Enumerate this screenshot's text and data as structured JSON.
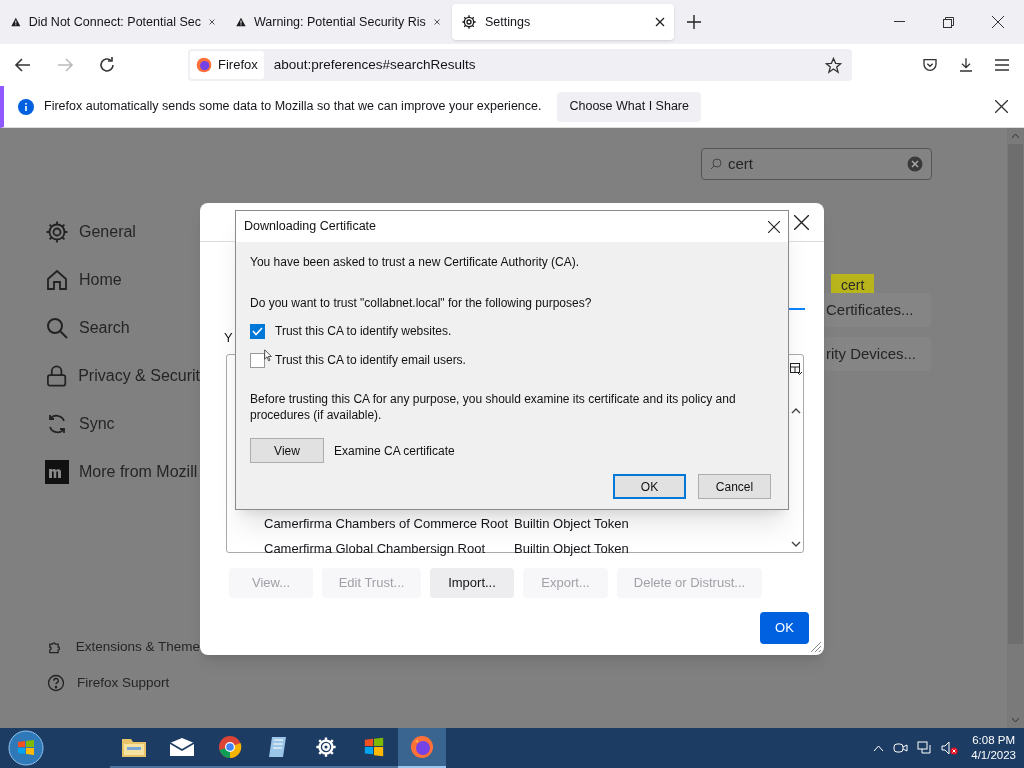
{
  "browser": {
    "tabs": [
      {
        "label": "Did Not Connect: Potential Sec",
        "kind": "warning",
        "selected": false
      },
      {
        "label": "Warning: Potential Security Ris",
        "kind": "warning",
        "selected": false
      },
      {
        "label": "Settings",
        "kind": "settings",
        "selected": true
      }
    ],
    "identity": "Firefox",
    "url": "about:preferences#searchResults",
    "notification": {
      "message": "Firefox automatically sends some data to Mozilla so that we can improve your experience.",
      "button": "Choose What I Share"
    }
  },
  "settings": {
    "search": {
      "value": "cert"
    },
    "sidebar": [
      {
        "label": "General",
        "kind": "gear"
      },
      {
        "label": "Home",
        "kind": "home"
      },
      {
        "label": "Search",
        "kind": "search"
      },
      {
        "label": "Privacy & Securit",
        "kind": "lock"
      },
      {
        "label": "Sync",
        "kind": "sync"
      },
      {
        "label": "More from Mozill",
        "kind": "mozilla"
      }
    ],
    "footer": [
      {
        "label": "Extensions & Theme",
        "kind": "puzzle"
      },
      {
        "label": "Firefox Support",
        "kind": "help"
      }
    ],
    "highlight": "cert",
    "buttons": [
      "Certificates...",
      "rity Devices..."
    ]
  },
  "certificate_manager": {
    "partial_text": "Y",
    "rows": [
      {
        "name": "Camerfirma Chambers of Commerce Root",
        "token": "Builtin Object Token"
      },
      {
        "name": "Camerfirma Global Chambersign Root",
        "token": "Builtin Object Token"
      }
    ],
    "actions": [
      {
        "label": "View...",
        "disabled": true
      },
      {
        "label": "Edit Trust...",
        "disabled": true
      },
      {
        "label": "Import...",
        "disabled": false
      },
      {
        "label": "Export...",
        "disabled": true
      },
      {
        "label": "Delete or Distrust...",
        "disabled": true
      }
    ],
    "ok": "OK"
  },
  "dialog": {
    "title": "Downloading Certificate",
    "intro": "You have been asked to trust a new Certificate Authority (CA).",
    "question": "Do you want to trust \"collabnet.local\" for the following purposes?",
    "options": [
      {
        "label": "Trust this CA to identify websites.",
        "checked": true
      },
      {
        "label": "Trust this CA to identify email users.",
        "checked": false
      }
    ],
    "warning": "Before trusting this CA for any purpose, you should examine its certificate and its policy and procedures (if available).",
    "view_button": "View",
    "view_label": "Examine CA certificate",
    "buttons": [
      {
        "label": "OK",
        "kind": "default"
      },
      {
        "label": "Cancel",
        "kind": "normal"
      }
    ]
  },
  "taskbar": {
    "apps": [
      {
        "kind": "folder",
        "selected": false
      },
      {
        "kind": "mail",
        "selected": false
      },
      {
        "kind": "chrome",
        "selected": false
      },
      {
        "kind": "notepad",
        "selected": false
      },
      {
        "kind": "settings",
        "selected": false
      },
      {
        "kind": "windows",
        "selected": false
      },
      {
        "kind": "firefox",
        "selected": true
      }
    ],
    "time": "6:08 PM",
    "date": "4/1/2023"
  }
}
